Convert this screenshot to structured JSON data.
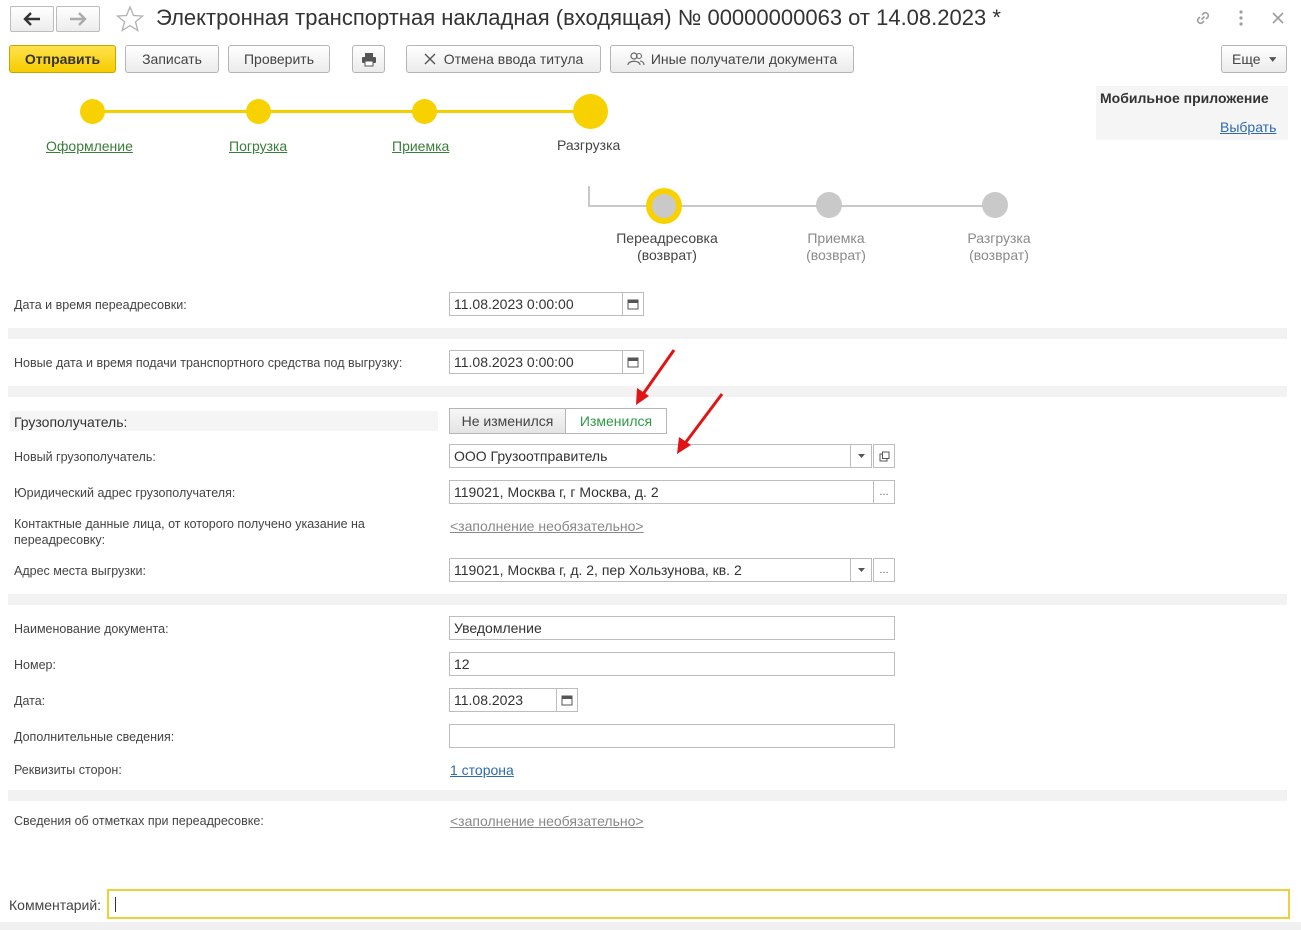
{
  "header": {
    "title": "Электронная транспортная накладная (входящая) № 00000000063 от 14.08.2023 *"
  },
  "toolbar": {
    "send": "Отправить",
    "save": "Записать",
    "check": "Проверить",
    "cancel_title": "Отмена ввода титула",
    "other_recipients": "Иные получатели документа",
    "more": "Еще"
  },
  "mobile": {
    "title": "Мобильное приложение",
    "choose": "Выбрать"
  },
  "stages": [
    {
      "label": "Оформление"
    },
    {
      "label": "Погрузка"
    },
    {
      "label": "Приемка"
    },
    {
      "label": "Разгрузка"
    }
  ],
  "substages": [
    {
      "line1": "Переадресовка",
      "line2": "(возврат)"
    },
    {
      "line1": "Приемка",
      "line2": "(возврат)"
    },
    {
      "line1": "Разгрузка",
      "line2": "(возврат)"
    }
  ],
  "form": {
    "redirect_datetime_label": "Дата и время переадресовки:",
    "redirect_datetime_value": "11.08.2023  0:00:00",
    "new_datetime_label": "Новые дата и время подачи транспортного средства под выгрузку:",
    "new_datetime_value": "11.08.2023  0:00:00",
    "consignee_label": "Грузополучатель:",
    "toggle_unchanged": "Не изменился",
    "toggle_changed": "Изменился",
    "new_consignee_label": "Новый грузополучатель:",
    "new_consignee_value": "ООО Грузоотправитель",
    "legal_address_label": "Юридический адрес грузополучателя:",
    "legal_address_value": "119021, Москва г, г Москва, д. 2",
    "contact_label_line1": "Контактные данные лица, от которого получено указание на",
    "contact_label_line2": "переадресовку:",
    "optional_placeholder": "<заполнение необязательно>",
    "unload_address_label": "Адрес места выгрузки:",
    "unload_address_value": "119021, Москва г, д. 2, пер Хользунова, кв. 2",
    "doc_name_label": "Наименование документа:",
    "doc_name_value": "Уведомление",
    "number_label": "Номер:",
    "number_value": "12",
    "date_label": "Дата:",
    "date_value": "11.08.2023",
    "extra_label": "Дополнительные сведения:",
    "extra_value": "",
    "parties_label": "Реквизиты сторон:",
    "parties_value": "1 сторона",
    "marks_label": "Сведения об отметках при переадресовке:",
    "marks_value": "<заполнение необязательно>",
    "comment_label": "Комментарий:",
    "comment_value": ""
  },
  "colors": {
    "accent_yellow": "#f8d200",
    "link_green": "#3a7d3a",
    "link_blue": "#2e6ab1",
    "arrow_red": "#e01414"
  }
}
